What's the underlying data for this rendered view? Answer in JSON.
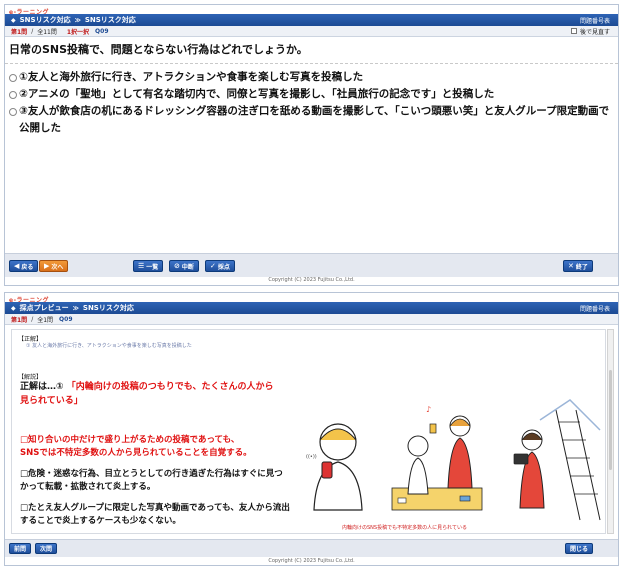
{
  "brand": "e-ラーニング",
  "top": {
    "title_app": "SNSリスク対応",
    "title_section": "SNSリスク対応",
    "right_label": "問題番号表",
    "q_current": "第1問",
    "q_total": "全11問",
    "q_type": "1択一択",
    "q_id": "Q09",
    "checkbox_label": "後で見直す",
    "question": "日常のSNS投稿で、問題とならない行為はどれでしょうか。",
    "choices": [
      "①友人と海外旅行に行き、アトラクションや食事を楽しむ写真を投稿した",
      "②アニメの「聖地」として有名な踏切内で、同僚と写真を撮影し、「社員旅行の記念です」と投稿した",
      "③友人が飲食店の机にあるドレッシング容器の注ぎ口を舐める動画を撮影して、「こいつ頭悪い笑」と友人グループ限定動画で公開した"
    ],
    "buttons": {
      "back": "戻る",
      "next": "次へ",
      "list": "一覧",
      "pause": "中断",
      "score": "採点",
      "end": "終了"
    },
    "copyright": "Copyright (C) 2023 Fujitsu Co.,Ltd."
  },
  "bottom": {
    "title_app": "採点プレビュー",
    "title_section": "SNSリスク対応",
    "right_label": "問題番号表",
    "q_current": "第1問",
    "q_total": "全1問",
    "q_id": "Q09",
    "tag_answer": "【正解】",
    "answer_small": "① 友人と海外旅行に行き、アトラクションや食事を楽しむ写真を投稿した",
    "tag_explain": "【解説】",
    "answer_label": "正解は…①",
    "answer_red": "「内輪向けの投稿のつもりでも、たくさんの人から見られている」",
    "b1_a": "□知り合いの中だけで盛り上がるための投稿であっても、",
    "b1_b": "SNSでは不特定多数の人から見られていることを自覚する。",
    "b2": "□危険・迷惑な行為、目立とうとしての行き過ぎた行為はすぐに見つかって転載・拡散されて炎上する。",
    "b3": "□たとえ友人グループに限定した写真や動画であっても、友人から流出することで炎上するケースも少なくない。",
    "caption": "内輪向けのSNS投稿でも不特定多数の人に見られている",
    "buttons": {
      "prev": "前問",
      "next": "次問",
      "close": "閉じる"
    },
    "copyright": "Copyright (C) 2023 Fujitsu Co.,Ltd."
  }
}
